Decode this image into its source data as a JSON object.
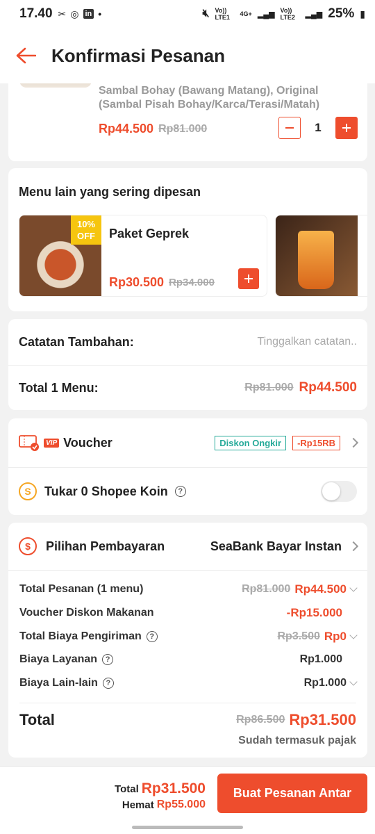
{
  "status": {
    "time": "17.40",
    "battery": "25%",
    "sim1": "Vo)) LTE1",
    "net": "4G+",
    "sim2": "Vo)) LTE2"
  },
  "header": {
    "title": "Konfirmasi Pesanan"
  },
  "order_item": {
    "variant_line1": "Sambal Bohay (Bawang Matang), Original",
    "variant_line2": "(Sambal Pisah Bohay/Karca/Terasi/Matah)",
    "price": "Rp44.500",
    "original_price": "Rp81.000",
    "quantity": "1"
  },
  "recommend": {
    "title": "Menu lain yang sering dipesan",
    "items": [
      {
        "name": "Paket Geprek",
        "price": "Rp30.500",
        "original_price": "Rp34.000",
        "badge_pct": "10%",
        "badge_off": "OFF"
      }
    ]
  },
  "notes": {
    "label": "Catatan Tambahan:",
    "placeholder": "Tinggalkan catatan.."
  },
  "total_menu": {
    "label": "Total 1 Menu:",
    "original": "Rp81.000",
    "price": "Rp44.500"
  },
  "voucher": {
    "vip": "VIP",
    "label": "Voucher",
    "tag1": "Diskon Ongkir",
    "tag2": "-Rp15RB"
  },
  "coin": {
    "label": "Tukar 0 Shopee Koin"
  },
  "payment": {
    "label": "Pilihan Pembayaran",
    "value": "SeaBank Bayar Instan"
  },
  "summary": {
    "rows": [
      {
        "label": "Total Pesanan (1 menu)",
        "original": "Rp81.000",
        "value": "Rp44.500"
      },
      {
        "label": "Voucher Diskon Makanan",
        "value": "-Rp15.000"
      },
      {
        "label": "Total Biaya Pengiriman",
        "original": "Rp3.500",
        "value": "Rp0"
      },
      {
        "label": "Biaya Layanan",
        "value": "Rp1.000"
      },
      {
        "label": "Biaya Lain-lain",
        "value": "Rp1.000"
      }
    ],
    "total_label": "Total",
    "total_original": "Rp86.500",
    "total_value": "Rp31.500",
    "tax_note": "Sudah termasuk pajak"
  },
  "bottom": {
    "total_label": "Total",
    "total_value": "Rp31.500",
    "save_label": "Hemat",
    "save_value": "Rp55.000",
    "cta": "Buat Pesanan Antar"
  },
  "colors": {
    "accent": "#ee4d2d",
    "teal": "#26aa99",
    "coin": "#f5a623"
  }
}
